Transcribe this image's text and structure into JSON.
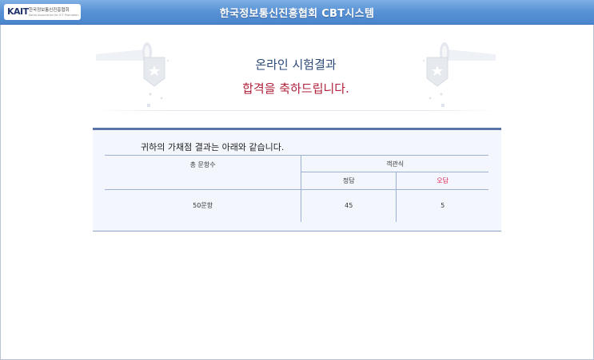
{
  "header": {
    "logo_mark": "KAIT",
    "logo_text": "한국정보통신진흥협회",
    "logo_subtext": "Korea Association for ICT Promotion",
    "title": "한국정보통신진흥협회 CBT시스템"
  },
  "result": {
    "heading": "온라인 시험결과",
    "congrats": "합격을 축하드립니다.",
    "message": "귀하의 가채점 결과는 아래와 같습니다.",
    "table": {
      "col_total": "총 문항수",
      "col_objective": "객관식",
      "col_correct": "정답",
      "col_wrong": "오답",
      "total_value": "50문항",
      "correct_value": "45",
      "wrong_value": "5"
    }
  },
  "colors": {
    "header_bar": "#5a93d6",
    "heading_text": "#2c4a78",
    "congrats_text": "#b0203a",
    "wrong_label": "#e0184c",
    "panel_bg": "#f3f7fd",
    "panel_border": "#5a74a8"
  },
  "icons": [
    "trumpet-icon",
    "star-badge-icon"
  ]
}
